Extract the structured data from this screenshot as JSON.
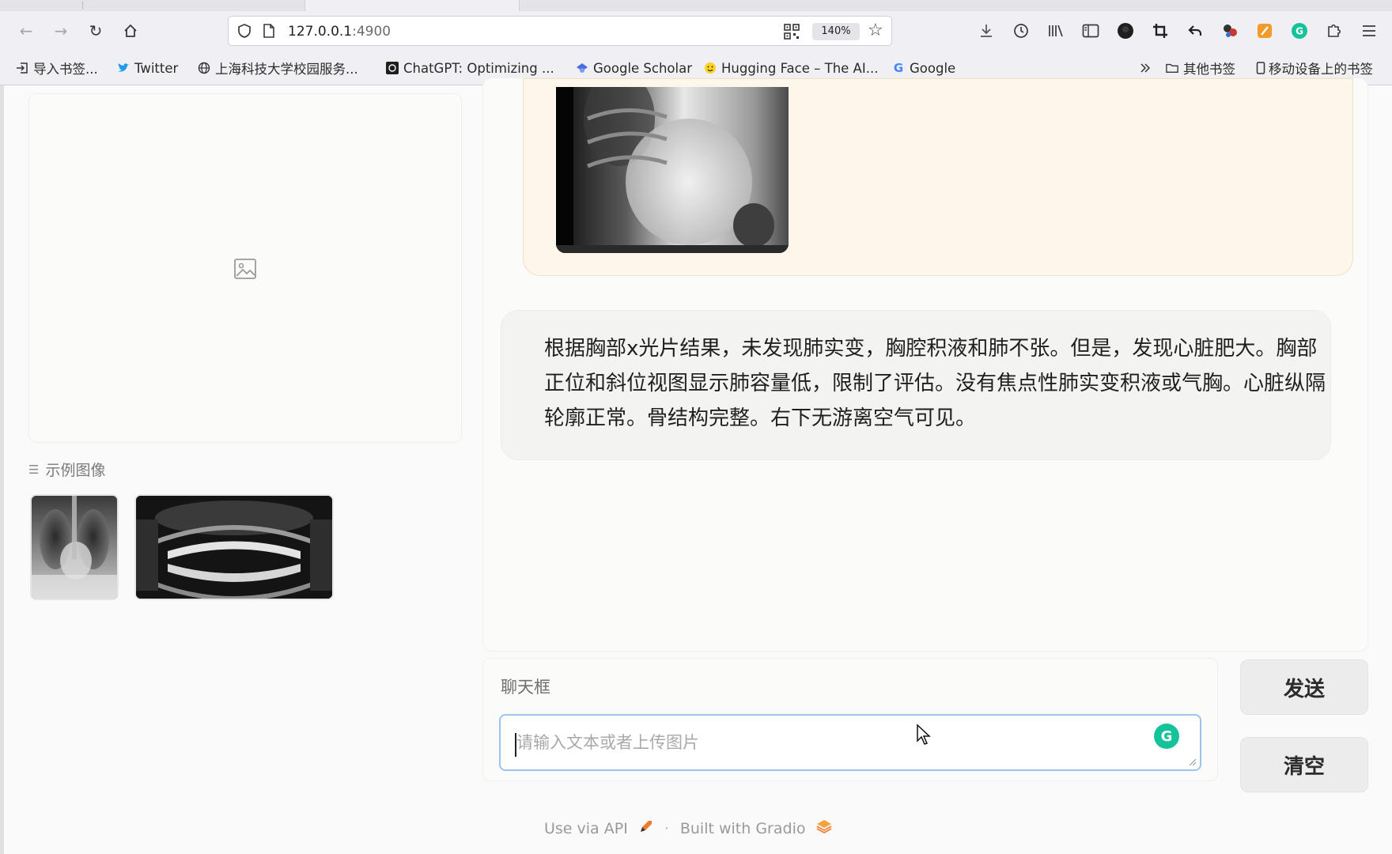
{
  "browser": {
    "url_host": "127.0.0.1",
    "url_port": ":4900",
    "zoom": "140%",
    "bookmarks": [
      {
        "label": "导入书签...",
        "icon": "import-icon"
      },
      {
        "label": "Twitter",
        "icon": "twitter-icon"
      },
      {
        "label": "上海科技大学校园服务...",
        "icon": "globe-icon"
      },
      {
        "label": "ChatGPT: Optimizing ...",
        "icon": "chatgpt-icon"
      },
      {
        "label": "Google Scholar",
        "icon": "scholar-icon"
      },
      {
        "label": "Hugging Face – The AI...",
        "icon": "huggingface-icon"
      },
      {
        "label": "Google",
        "icon": "google-icon"
      }
    ],
    "other_bookmarks": "其他书签",
    "mobile_bookmarks": "移动设备上的书签"
  },
  "sidebar": {
    "examples_label": "示例图像",
    "examples": [
      {
        "name": "chest-xray-example"
      },
      {
        "name": "dental-panoramic-example"
      }
    ]
  },
  "chat": {
    "bot_message": "根据胸部x光片结果，未发现肺实变，胸腔积液和肺不张。但是，发现心脏肥大。胸部正位和斜位视图显示肺容量低，限制了评估。没有焦点性肺实变积液或气胸。心脏纵隔轮廓正常。骨结构完整。右下无游离空气可见。"
  },
  "input": {
    "label": "聊天框",
    "placeholder": "请输入文本或者上传图片"
  },
  "buttons": {
    "send": "发送",
    "clear": "清空"
  },
  "footer": {
    "api": "Use via API",
    "separator": "·",
    "built": "Built with Gradio"
  }
}
